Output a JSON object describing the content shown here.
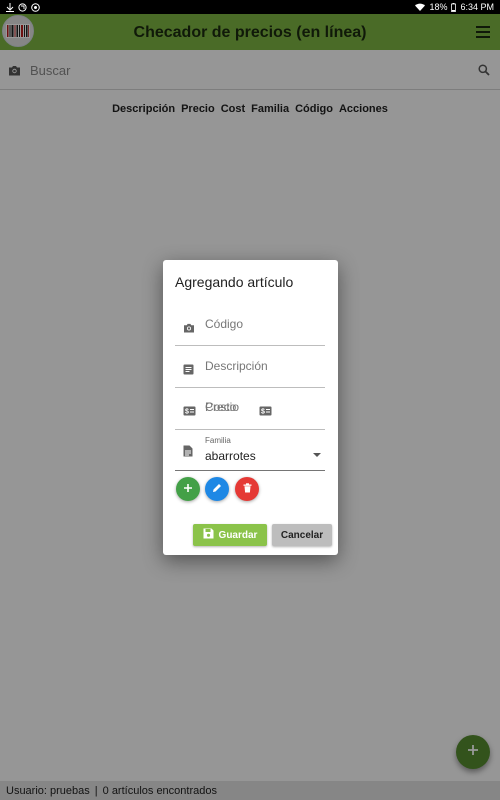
{
  "status_bar": {
    "battery": "18%",
    "time": "6:34 PM",
    "icons": [
      "download-icon",
      "sync-icon",
      "chrome-icon",
      "wifi-icon",
      "battery-icon"
    ]
  },
  "app_bar": {
    "title": "Checador de precios (en línea)",
    "logo_icon": "barcode-icon",
    "menu_icon": "menu-icon",
    "color": "#7cb342"
  },
  "search": {
    "placeholder": "Buscar",
    "camera_icon": "camera-icon",
    "search_icon": "search-icon"
  },
  "table": {
    "columns": [
      "Descripción",
      "Precio",
      "Cost",
      "Familia",
      "Código",
      "Acciones"
    ]
  },
  "dialog": {
    "title": "Agregando artículo",
    "fields": {
      "codigo_placeholder": "Código",
      "descripcion_placeholder": "Descripción",
      "precio_placeholder": "Precio",
      "costo_placeholder": "Costo",
      "familia_label": "Familia",
      "familia_value": "abarrotes"
    },
    "icon_buttons": [
      {
        "icon": "plus-icon",
        "color": "#43a047"
      },
      {
        "icon": "pencil-icon",
        "color": "#1e88e5"
      },
      {
        "icon": "trash-icon",
        "color": "#e53935"
      }
    ],
    "save_label": "Guardar",
    "cancel_label": "Cancelar"
  },
  "fab": {
    "icon": "plus-icon",
    "color": "#558b2f"
  },
  "footer": {
    "user_text": "Usuario: pruebas",
    "separator": "|",
    "count_text": "0 artículos encontrados"
  }
}
